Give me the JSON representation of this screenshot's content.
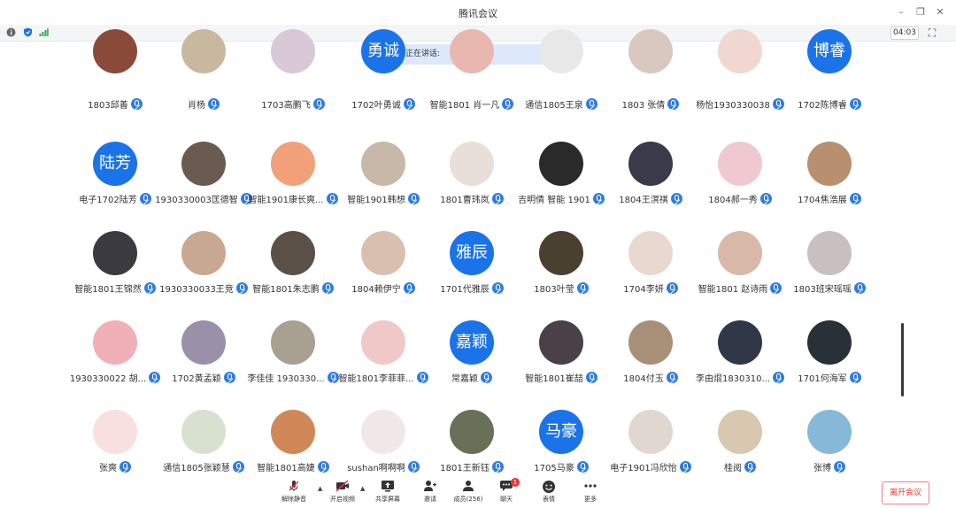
{
  "window": {
    "title": "腾讯会议",
    "minimize": "–",
    "restore": "❐",
    "close": "✕"
  },
  "status": {
    "timer": "04:03"
  },
  "speaking_label": "正在讲话:",
  "participants": [
    {
      "name": "1803邱善",
      "avatar_text": "",
      "color": "#8a4a3a"
    },
    {
      "name": "肖杨",
      "avatar_text": "",
      "color": "#c9b8a0"
    },
    {
      "name": "1703高鹏飞",
      "avatar_text": "",
      "color": "#d8c8d8"
    },
    {
      "name": "1702叶勇诚",
      "avatar_text": "勇诚",
      "color": "#1a73e8"
    },
    {
      "name": "智能1801 肖一凡",
      "avatar_text": "",
      "color": "#e8b8b0"
    },
    {
      "name": "通信1805王泉",
      "avatar_text": "",
      "color": "#e8e8e8"
    },
    {
      "name": "1803 张倩",
      "avatar_text": "",
      "color": "#d8c8c0"
    },
    {
      "name": "杨怡1930330038",
      "avatar_text": "",
      "color": "#f0d8d0"
    },
    {
      "name": "1702陈博睿",
      "avatar_text": "博睿",
      "color": "#1a73e8"
    },
    {
      "name": "电子1702陆芳",
      "avatar_text": "陆芳",
      "color": "#1a73e8"
    },
    {
      "name": "1930330003匡德智",
      "avatar_text": "",
      "color": "#6a5a50"
    },
    {
      "name": "智能1901康长爽...",
      "avatar_text": "",
      "color": "#f2a07a"
    },
    {
      "name": "智能1901韩想",
      "avatar_text": "",
      "color": "#c8b8a8"
    },
    {
      "name": "1801曹玮岚",
      "avatar_text": "",
      "color": "#e8e0d8"
    },
    {
      "name": "吉明倩 智能 1901",
      "avatar_text": "",
      "color": "#2a2a2a"
    },
    {
      "name": "1804王溟祺",
      "avatar_text": "",
      "color": "#3a3a4a"
    },
    {
      "name": "1804郝一秀",
      "avatar_text": "",
      "color": "#f0c8d0"
    },
    {
      "name": "1704焦浩展",
      "avatar_text": "",
      "color": "#b89070"
    },
    {
      "name": "智能1801王锦然",
      "avatar_text": "",
      "color": "#3a3a40"
    },
    {
      "name": "1930330033王竞",
      "avatar_text": "",
      "color": "#c8a890"
    },
    {
      "name": "智能1801朱志鹏",
      "avatar_text": "",
      "color": "#5a5048"
    },
    {
      "name": "1804赖伊宁",
      "avatar_text": "",
      "color": "#d8c0b0"
    },
    {
      "name": "1701代雅辰",
      "avatar_text": "雅辰",
      "color": "#1a73e8"
    },
    {
      "name": "1803叶莹",
      "avatar_text": "",
      "color": "#4a4030"
    },
    {
      "name": "1704李妍",
      "avatar_text": "",
      "color": "#e8d8d0"
    },
    {
      "name": "智能1801 赵诗雨",
      "avatar_text": "",
      "color": "#d8b8a8"
    },
    {
      "name": "1803班宋瑶瑶",
      "avatar_text": "",
      "color": "#c8c0c0"
    },
    {
      "name": "1930330022 胡...",
      "avatar_text": "",
      "color": "#f0b0b8"
    },
    {
      "name": "1702黄孟颖",
      "avatar_text": "",
      "color": "#9a90a8"
    },
    {
      "name": "李佳佳 1930330...",
      "avatar_text": "",
      "color": "#a8a090"
    },
    {
      "name": "智能1801李菲菲...",
      "avatar_text": "",
      "color": "#f0c8c8"
    },
    {
      "name": "常嘉颖",
      "avatar_text": "嘉颖",
      "color": "#1a73e8"
    },
    {
      "name": "智能1801崔喆",
      "avatar_text": "",
      "color": "#4a4048"
    },
    {
      "name": "1804付玉",
      "avatar_text": "",
      "color": "#a89078"
    },
    {
      "name": "李由焜1830310...",
      "avatar_text": "",
      "color": "#303848"
    },
    {
      "name": "1701何海军",
      "avatar_text": "",
      "color": "#283038"
    },
    {
      "name": "张爽",
      "avatar_text": "",
      "color": "#f8e0e0"
    },
    {
      "name": "通信1805张颖慧",
      "avatar_text": "",
      "color": "#d8e0d0"
    },
    {
      "name": "智能1801高婕",
      "avatar_text": "",
      "color": "#d08858"
    },
    {
      "name": "sushan啊啊啊",
      "avatar_text": "",
      "color": "#f0e8e8"
    },
    {
      "name": "1801王新钰",
      "avatar_text": "",
      "color": "#687058"
    },
    {
      "name": "1705马豪",
      "avatar_text": "马豪",
      "color": "#1a73e8"
    },
    {
      "name": "电子1901冯欣怡",
      "avatar_text": "",
      "color": "#e0d8d0"
    },
    {
      "name": "桂阅",
      "avatar_text": "",
      "color": "#d8c8b0"
    },
    {
      "name": "张博",
      "avatar_text": "",
      "color": "#88b8d8"
    }
  ],
  "toolbar": {
    "mute": "解除静音",
    "video": "开启视频",
    "share": "共享屏幕",
    "invite": "邀请",
    "members": "成员(256)",
    "chat": "聊天",
    "chat_badge": "1",
    "emoji": "表情",
    "more": "更多",
    "leave": "离开会议"
  }
}
